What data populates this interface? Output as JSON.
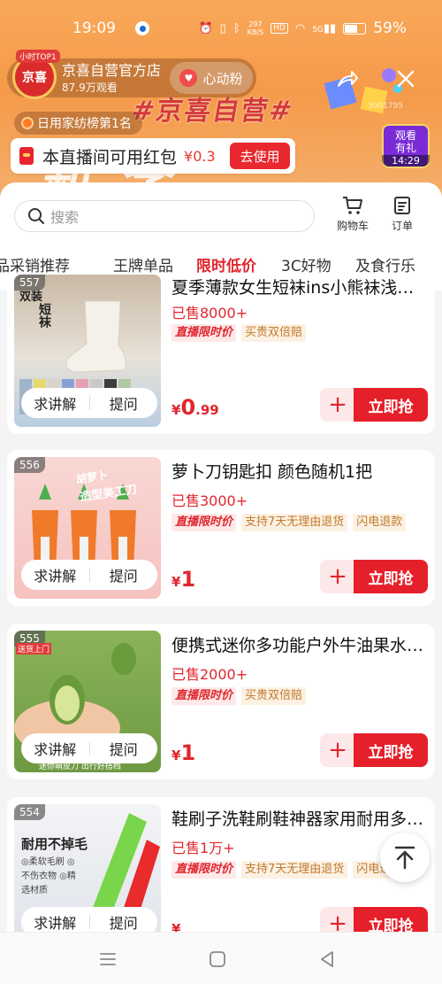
{
  "status_bar": {
    "time": "19:09",
    "network_speed_value": "297",
    "network_speed_unit": "KB/S",
    "hd": "HD",
    "signal": "5G",
    "battery": "59%"
  },
  "live": {
    "top_tag": "小时TOP1",
    "avatar_text": "京喜",
    "anchor_name": "京喜自营官方店",
    "views": "87.9万观看",
    "fan_button": "心动粉",
    "room_id": "3001795",
    "rank_text": "日用家纺榜第1名",
    "banner_text": "#京喜自营#",
    "banner_big": "新季",
    "red_packet_text": "本直播间可用红包",
    "red_packet_amount": "¥0.3",
    "red_packet_button": "去使用",
    "gift_label_1": "观看",
    "gift_label_2": "有礼",
    "gift_time": "14:29"
  },
  "panel": {
    "search_placeholder": "搜索",
    "cart_label": "购物车",
    "order_label": "订单",
    "tabs": [
      {
        "label": "品采销推荐",
        "active": false
      },
      {
        "label": "王牌单品",
        "active": false
      },
      {
        "label": "限时低价",
        "active": true
      },
      {
        "label": "3C好物",
        "active": false
      },
      {
        "label": "及食行乐",
        "active": false
      }
    ]
  },
  "products": [
    {
      "num": "557",
      "title": "夏季薄款女生短袜ins小熊袜浅…",
      "sold": "已售8000+",
      "tags": [
        {
          "text": "直播限时价",
          "type": "live"
        },
        {
          "text": "买贵双倍赔",
          "type": "normal"
        }
      ],
      "price_currency": "¥",
      "price_int": "0",
      "price_dec": ".99",
      "explain": "求讲解",
      "ask": "提问",
      "buy": "立即抢",
      "add": "+",
      "thumb_text_1": "双装",
      "thumb_text_2": "短袜"
    },
    {
      "num": "556",
      "title": "萝卜刀钥匙扣 颜色随机1把",
      "sold": "已售3000+",
      "tags": [
        {
          "text": "直播限时价",
          "type": "live"
        },
        {
          "text": "支持7天无理由退货",
          "type": "normal"
        },
        {
          "text": "闪电退款",
          "type": "normal"
        }
      ],
      "price_currency": "¥",
      "price_int": "1",
      "price_dec": "",
      "explain": "求讲解",
      "ask": "提问",
      "buy": "立即抢",
      "add": "+",
      "thumb_text_1": "胡萝卜",
      "thumb_text_2": "造型美工刀"
    },
    {
      "num": "555",
      "title": "便携式迷你多功能户外牛油果水…",
      "sold": "已售2000+",
      "tags": [
        {
          "text": "直播限时价",
          "type": "live"
        },
        {
          "text": "买贵双倍赔",
          "type": "normal"
        }
      ],
      "price_currency": "¥",
      "price_int": "1",
      "price_dec": "",
      "explain": "求讲解",
      "ask": "提问",
      "buy": "立即抢",
      "add": "+",
      "thumb_text_1": "送货上门",
      "thumb_text_2": "迷你萌皮刀 出行好搭档"
    },
    {
      "num": "554",
      "title": "鞋刷子洗鞋刷鞋神器家用耐用多…",
      "sold": "已售1万+",
      "tags": [
        {
          "text": "直播限时价",
          "type": "live"
        },
        {
          "text": "支持7天无理由退货",
          "type": "normal"
        },
        {
          "text": "闪电退款",
          "type": "normal"
        }
      ],
      "price_currency": "¥",
      "price_int": "",
      "price_dec": "",
      "explain": "求讲解",
      "ask": "提问",
      "buy": "立即抢",
      "add": "+",
      "thumb_text_1": "耐用不掉毛",
      "thumb_text_2": "◎柔软毛刷 ◎不伤衣物 ◎精选材质"
    }
  ],
  "colors": {
    "accent_red": "#e6202a",
    "live_bg": "#f59a49"
  }
}
